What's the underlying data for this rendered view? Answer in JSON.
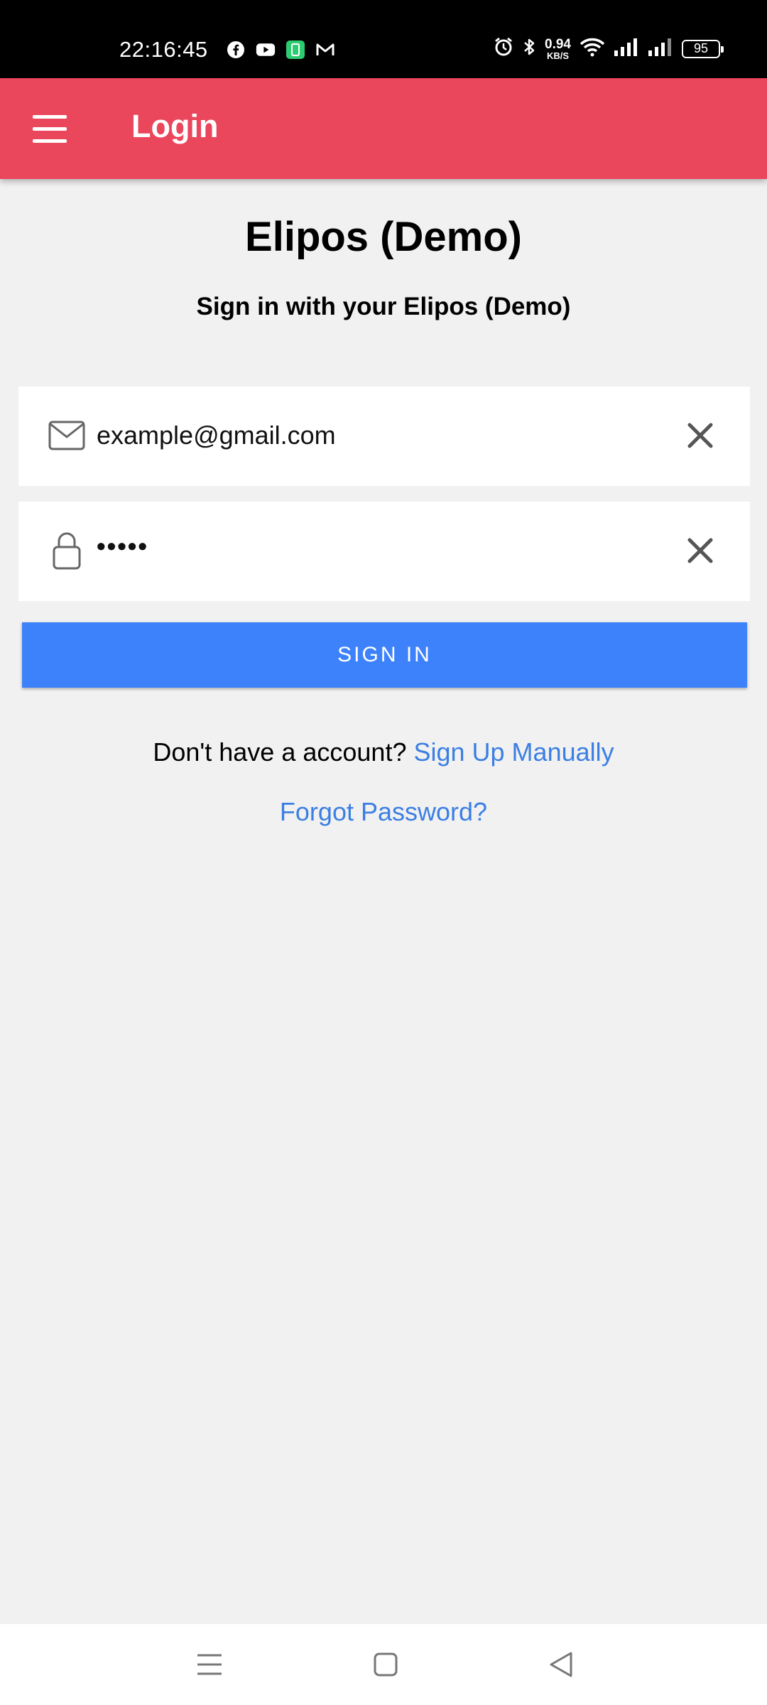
{
  "status_bar": {
    "time": "22:16:45",
    "network_speed_value": "0.94",
    "network_speed_unit": "KB/S",
    "battery": "95",
    "icons": [
      "facebook-icon",
      "youtube-icon",
      "green-app-icon",
      "gmail-icon",
      "alarm-icon",
      "bluetooth-icon",
      "wifi-icon",
      "signal-icon",
      "signal-icon-2",
      "battery-icon"
    ]
  },
  "app_bar": {
    "title": "Login",
    "menu_icon": "hamburger-menu-icon",
    "background": "#ea465c"
  },
  "header": {
    "title": "Elipos (Demo)",
    "subtitle": "Sign in with your Elipos (Demo)"
  },
  "form": {
    "email": {
      "value": "example@gmail.com",
      "icon": "mail-icon",
      "clear_icon": "close-icon"
    },
    "password": {
      "value": "•••••",
      "icon": "lock-icon",
      "clear_icon": "close-icon"
    },
    "sign_in_label": "SIGN IN",
    "sign_in_color": "#3d82fb"
  },
  "footer_links": {
    "account_prompt": "Don't have a account?",
    "sign_up_label": "Sign Up Manually",
    "forgot_label": "Forgot Password?",
    "link_color": "#3b7fe3"
  },
  "nav_bar": {
    "icons": [
      "recent-apps-icon",
      "home-icon",
      "back-icon"
    ]
  }
}
